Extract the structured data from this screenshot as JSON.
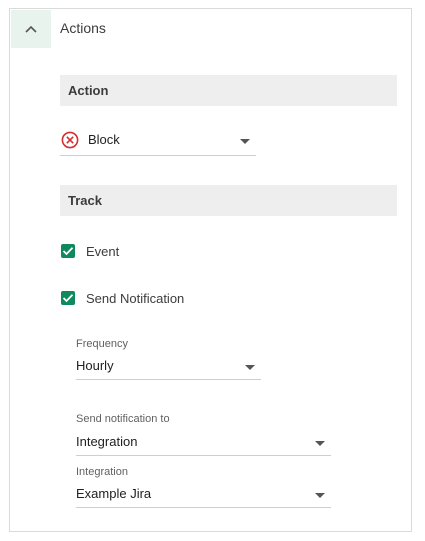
{
  "panel": {
    "title": "Actions"
  },
  "action_section": {
    "header": "Action",
    "action_select": {
      "value": "Block"
    }
  },
  "track_section": {
    "header": "Track",
    "event_checkbox": {
      "label": "Event",
      "checked": true
    },
    "notification_checkbox": {
      "label": "Send Notification",
      "checked": true
    },
    "frequency": {
      "label": "Frequency",
      "value": "Hourly"
    },
    "send_to": {
      "label": "Send notification to",
      "value": "Integration"
    },
    "integration": {
      "label": "Integration",
      "value": "Example Jira"
    }
  },
  "colors": {
    "accent": "#0f8a5f",
    "collapse_bg": "#e8f3ee",
    "block_icon": "#d32f2f",
    "section_bg": "#eeeeee"
  },
  "icons": {
    "collapse": "chevron-up-icon",
    "block": "circle-x-icon",
    "dropdown": "caret-down-icon",
    "checkbox": "checkmark-icon"
  }
}
